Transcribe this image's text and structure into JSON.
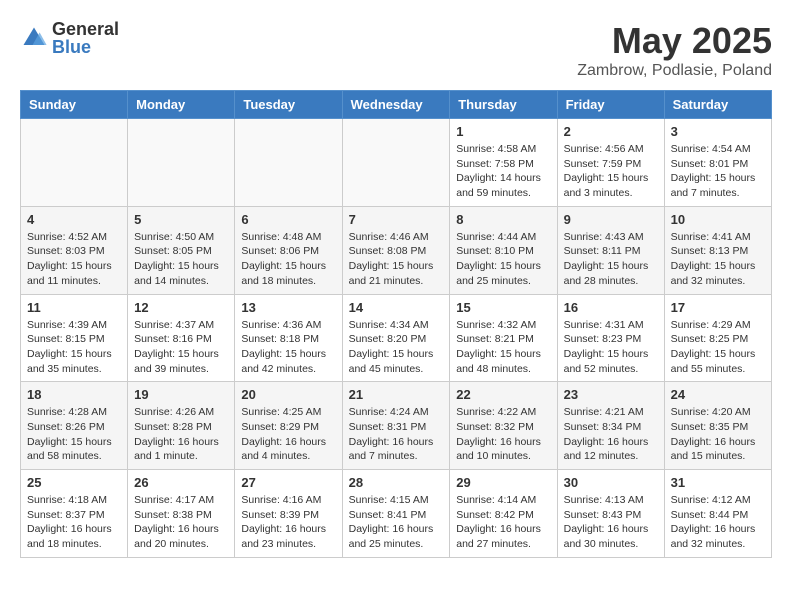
{
  "logo": {
    "general": "General",
    "blue": "Blue"
  },
  "title": "May 2025",
  "subtitle": "Zambrow, Podlasie, Poland",
  "headers": [
    "Sunday",
    "Monday",
    "Tuesday",
    "Wednesday",
    "Thursday",
    "Friday",
    "Saturday"
  ],
  "weeks": [
    [
      {
        "day": "",
        "info": ""
      },
      {
        "day": "",
        "info": ""
      },
      {
        "day": "",
        "info": ""
      },
      {
        "day": "",
        "info": ""
      },
      {
        "day": "1",
        "info": "Sunrise: 4:58 AM\nSunset: 7:58 PM\nDaylight: 14 hours\nand 59 minutes."
      },
      {
        "day": "2",
        "info": "Sunrise: 4:56 AM\nSunset: 7:59 PM\nDaylight: 15 hours\nand 3 minutes."
      },
      {
        "day": "3",
        "info": "Sunrise: 4:54 AM\nSunset: 8:01 PM\nDaylight: 15 hours\nand 7 minutes."
      }
    ],
    [
      {
        "day": "4",
        "info": "Sunrise: 4:52 AM\nSunset: 8:03 PM\nDaylight: 15 hours\nand 11 minutes."
      },
      {
        "day": "5",
        "info": "Sunrise: 4:50 AM\nSunset: 8:05 PM\nDaylight: 15 hours\nand 14 minutes."
      },
      {
        "day": "6",
        "info": "Sunrise: 4:48 AM\nSunset: 8:06 PM\nDaylight: 15 hours\nand 18 minutes."
      },
      {
        "day": "7",
        "info": "Sunrise: 4:46 AM\nSunset: 8:08 PM\nDaylight: 15 hours\nand 21 minutes."
      },
      {
        "day": "8",
        "info": "Sunrise: 4:44 AM\nSunset: 8:10 PM\nDaylight: 15 hours\nand 25 minutes."
      },
      {
        "day": "9",
        "info": "Sunrise: 4:43 AM\nSunset: 8:11 PM\nDaylight: 15 hours\nand 28 minutes."
      },
      {
        "day": "10",
        "info": "Sunrise: 4:41 AM\nSunset: 8:13 PM\nDaylight: 15 hours\nand 32 minutes."
      }
    ],
    [
      {
        "day": "11",
        "info": "Sunrise: 4:39 AM\nSunset: 8:15 PM\nDaylight: 15 hours\nand 35 minutes."
      },
      {
        "day": "12",
        "info": "Sunrise: 4:37 AM\nSunset: 8:16 PM\nDaylight: 15 hours\nand 39 minutes."
      },
      {
        "day": "13",
        "info": "Sunrise: 4:36 AM\nSunset: 8:18 PM\nDaylight: 15 hours\nand 42 minutes."
      },
      {
        "day": "14",
        "info": "Sunrise: 4:34 AM\nSunset: 8:20 PM\nDaylight: 15 hours\nand 45 minutes."
      },
      {
        "day": "15",
        "info": "Sunrise: 4:32 AM\nSunset: 8:21 PM\nDaylight: 15 hours\nand 48 minutes."
      },
      {
        "day": "16",
        "info": "Sunrise: 4:31 AM\nSunset: 8:23 PM\nDaylight: 15 hours\nand 52 minutes."
      },
      {
        "day": "17",
        "info": "Sunrise: 4:29 AM\nSunset: 8:25 PM\nDaylight: 15 hours\nand 55 minutes."
      }
    ],
    [
      {
        "day": "18",
        "info": "Sunrise: 4:28 AM\nSunset: 8:26 PM\nDaylight: 15 hours\nand 58 minutes."
      },
      {
        "day": "19",
        "info": "Sunrise: 4:26 AM\nSunset: 8:28 PM\nDaylight: 16 hours\nand 1 minute."
      },
      {
        "day": "20",
        "info": "Sunrise: 4:25 AM\nSunset: 8:29 PM\nDaylight: 16 hours\nand 4 minutes."
      },
      {
        "day": "21",
        "info": "Sunrise: 4:24 AM\nSunset: 8:31 PM\nDaylight: 16 hours\nand 7 minutes."
      },
      {
        "day": "22",
        "info": "Sunrise: 4:22 AM\nSunset: 8:32 PM\nDaylight: 16 hours\nand 10 minutes."
      },
      {
        "day": "23",
        "info": "Sunrise: 4:21 AM\nSunset: 8:34 PM\nDaylight: 16 hours\nand 12 minutes."
      },
      {
        "day": "24",
        "info": "Sunrise: 4:20 AM\nSunset: 8:35 PM\nDaylight: 16 hours\nand 15 minutes."
      }
    ],
    [
      {
        "day": "25",
        "info": "Sunrise: 4:18 AM\nSunset: 8:37 PM\nDaylight: 16 hours\nand 18 minutes."
      },
      {
        "day": "26",
        "info": "Sunrise: 4:17 AM\nSunset: 8:38 PM\nDaylight: 16 hours\nand 20 minutes."
      },
      {
        "day": "27",
        "info": "Sunrise: 4:16 AM\nSunset: 8:39 PM\nDaylight: 16 hours\nand 23 minutes."
      },
      {
        "day": "28",
        "info": "Sunrise: 4:15 AM\nSunset: 8:41 PM\nDaylight: 16 hours\nand 25 minutes."
      },
      {
        "day": "29",
        "info": "Sunrise: 4:14 AM\nSunset: 8:42 PM\nDaylight: 16 hours\nand 27 minutes."
      },
      {
        "day": "30",
        "info": "Sunrise: 4:13 AM\nSunset: 8:43 PM\nDaylight: 16 hours\nand 30 minutes."
      },
      {
        "day": "31",
        "info": "Sunrise: 4:12 AM\nSunset: 8:44 PM\nDaylight: 16 hours\nand 32 minutes."
      }
    ]
  ]
}
